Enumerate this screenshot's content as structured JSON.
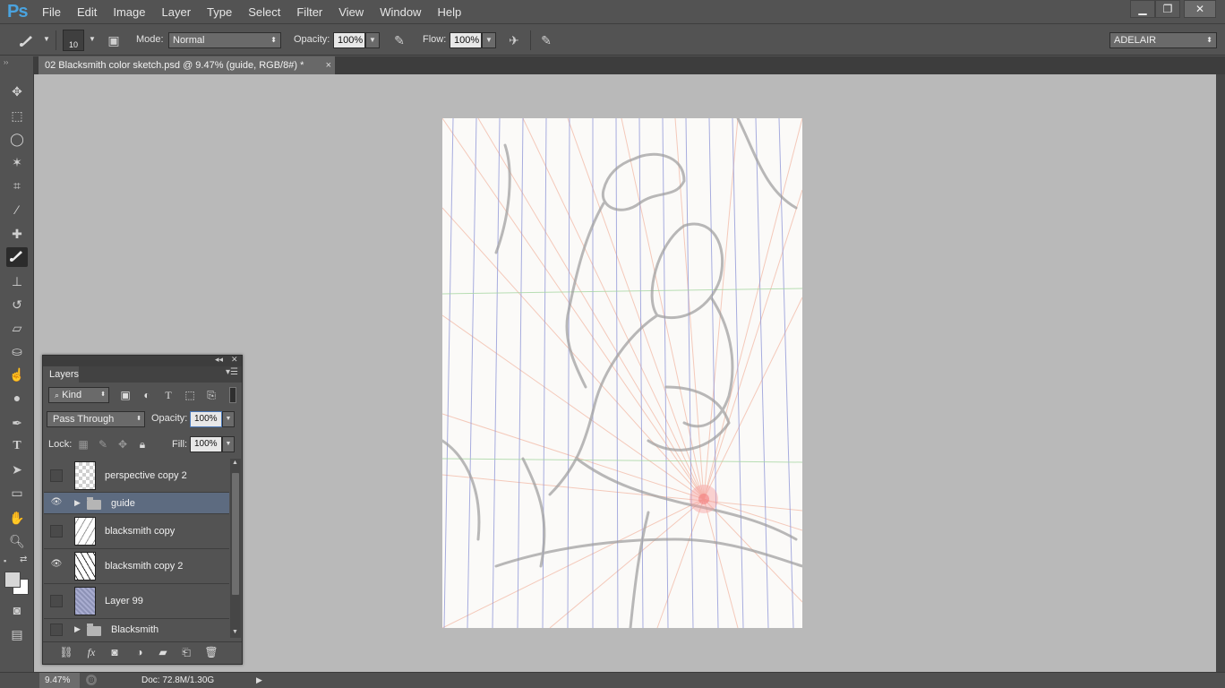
{
  "app": {
    "logo": "Ps"
  },
  "menu": [
    "File",
    "Edit",
    "Image",
    "Layer",
    "Type",
    "Select",
    "Filter",
    "View",
    "Window",
    "Help"
  ],
  "window_controls": {
    "minimize": "▁",
    "restore": "❐",
    "close": "✕"
  },
  "options": {
    "brush_size": "10",
    "mode_label": "Mode:",
    "mode_value": "Normal",
    "opacity_label": "Opacity:",
    "opacity_value": "100%",
    "flow_label": "Flow:",
    "flow_value": "100%",
    "workspace": "ADELAIR"
  },
  "document": {
    "tab_title": "02 Blacksmith color sketch.psd @ 9.47% (guide, RGB/8#) *",
    "close": "×"
  },
  "status": {
    "zoom": "9.47%",
    "doc_info": "Doc: 72.8M/1.30G"
  },
  "layers_panel": {
    "tab": "Layers",
    "kind_label": "Kind",
    "blend_mode": "Pass Through",
    "opacity_label": "Opacity:",
    "opacity_value": "100%",
    "lock_label": "Lock:",
    "fill_label": "Fill:",
    "fill_value": "100%",
    "layers": [
      {
        "name": "perspective copy 2",
        "visible": false,
        "type": "layer",
        "thumb": "checker"
      },
      {
        "name": "guide",
        "visible": true,
        "type": "group",
        "selected": true
      },
      {
        "name": "blacksmith copy",
        "visible": false,
        "type": "layer",
        "thumb": "sketch"
      },
      {
        "name": "blacksmith copy 2",
        "visible": true,
        "type": "layer",
        "thumb": "sketch2"
      },
      {
        "name": "Layer 99",
        "visible": false,
        "type": "layer",
        "thumb": "blue"
      },
      {
        "name": "Blacksmith",
        "visible": false,
        "type": "group"
      }
    ]
  },
  "colors": {
    "ui_bg": "#535353",
    "canvas_bg": "#b9b9b9",
    "selection": "#5d6b80",
    "logo": "#4aa3df"
  }
}
